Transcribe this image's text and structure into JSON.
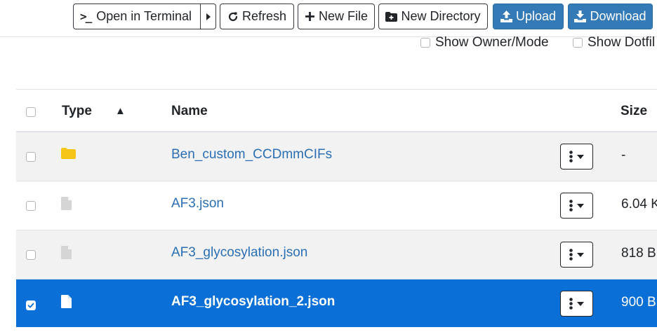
{
  "toolbar": {
    "open_terminal": "Open in Terminal",
    "refresh": "Refresh",
    "new_file": "New File",
    "new_directory": "New Directory",
    "upload": "Upload",
    "download": "Download"
  },
  "options": {
    "show_owner_mode": "Show Owner/Mode",
    "show_dotfiles": "Show Dotfil"
  },
  "table": {
    "headers": {
      "type": "Type",
      "name": "Name",
      "size": "Size"
    },
    "sort_indicator": "▲",
    "rows": [
      {
        "name": "Ben_custom_CCDmmCIFs",
        "size": "-",
        "type": "folder",
        "selected": false
      },
      {
        "name": "AF3.json",
        "size": "6.04 K",
        "type": "file",
        "selected": false
      },
      {
        "name": "AF3_glycosylation.json",
        "size": "818 B",
        "type": "file",
        "selected": false
      },
      {
        "name": "AF3_glycosylation_2.json",
        "size": "900 B",
        "type": "file",
        "selected": true
      }
    ]
  },
  "colors": {
    "primary_button": "#337ab7",
    "selected_row": "#0a6fd6",
    "link": "#2a6fb5",
    "folder_icon": "#f5c518",
    "file_icon": "#d5d5d5"
  }
}
